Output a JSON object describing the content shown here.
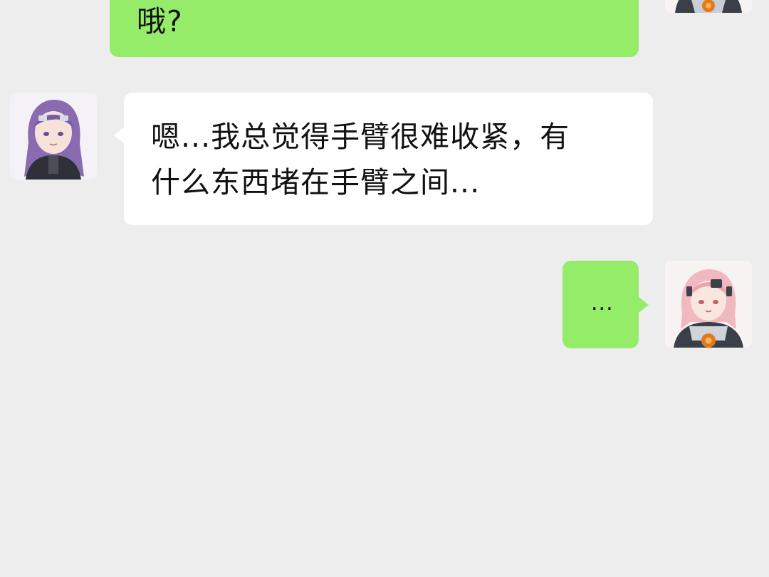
{
  "messages": [
    {
      "sender": "self",
      "avatar_icon": "pink-hair-girl-avatar-icon",
      "lines": [
        "哦?"
      ]
    },
    {
      "sender": "other",
      "avatar_icon": "purple-hair-girl-avatar-icon",
      "lines": [
        "嗯...我总觉得手臂很难收紧，有",
        "什么东西堵在手臂之间..."
      ]
    },
    {
      "sender": "self",
      "avatar_icon": "pink-hair-girl-avatar-icon",
      "lines": [
        "..."
      ]
    }
  ],
  "colors": {
    "background": "#ededed",
    "self_bubble": "#95ec69",
    "other_bubble": "#ffffff",
    "text": "#111111"
  }
}
